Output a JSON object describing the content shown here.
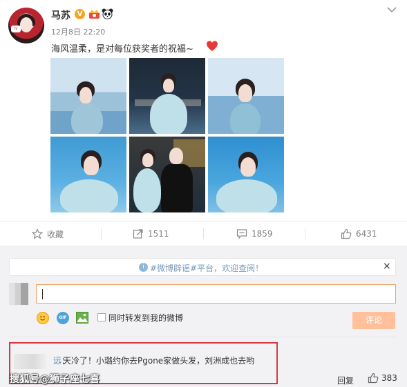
{
  "post": {
    "username": "马苏",
    "verified_badge": "V",
    "timestamp": "12月8日 22:20",
    "text": "海风温柔，是对每位获奖者的祝福~",
    "icons": [
      "verified-icon",
      "crown-icon",
      "panda-icon",
      "heart-icon",
      "chevron-down-icon"
    ]
  },
  "actions": {
    "favorite": "收藏",
    "forward_count": "1511",
    "comment_count": "1859",
    "like_count": "6431"
  },
  "comment_box": {
    "notice": "#微博辟谣#平台，欢迎查阅！",
    "notice_close": "×",
    "gif_label": "GIF",
    "also_forward_label": "同时转发到我的微博",
    "submit_label": "评论"
  },
  "comments": [
    {
      "username": "远",
      "separator": "：",
      "text": "天冷了！小璐约你去Pgone家做头发，刘洲成也去哟",
      "reply_label": "回复",
      "like_count": "383"
    }
  ],
  "watermark": "搜狐号@狮子座七喜",
  "colors": {
    "accent_orange": "#f5a066",
    "link_blue": "#5b84b2",
    "highlight_red": "#d23a45",
    "heart_red": "#e53935"
  }
}
